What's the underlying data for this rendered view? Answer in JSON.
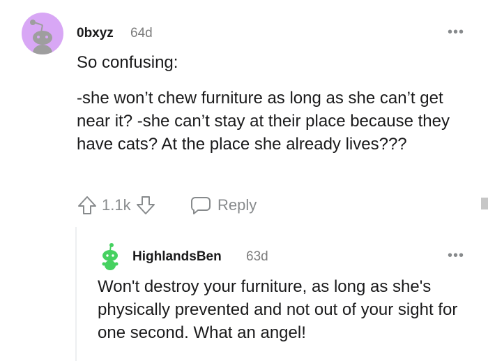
{
  "comments": [
    {
      "username": "0bxyz",
      "age": "64d",
      "paragraphs": [
        "So confusing:",
        "-she won’t chew furniture as long as she can’t get near it? -she can’t stay at their place because they have cats? At the place she already lives???"
      ],
      "votes": "1.1k",
      "reply_label": "Reply",
      "avatar_icon": "snoo-avatar-icon",
      "avatar_color": "#d8a7f5"
    },
    {
      "username": "HighlandsBen",
      "age": "63d",
      "paragraphs": [
        "Won't destroy your furniture, as long as she's physically prevented and not out of your sight for one second. What an angel!"
      ],
      "avatar_icon": "snoo-avatar-icon",
      "avatar_color": "#46d160"
    }
  ],
  "icons": {
    "more": "more-options-icon",
    "upvote": "upvote-arrow-icon",
    "downvote": "downvote-arrow-icon",
    "reply": "speech-bubble-icon"
  }
}
